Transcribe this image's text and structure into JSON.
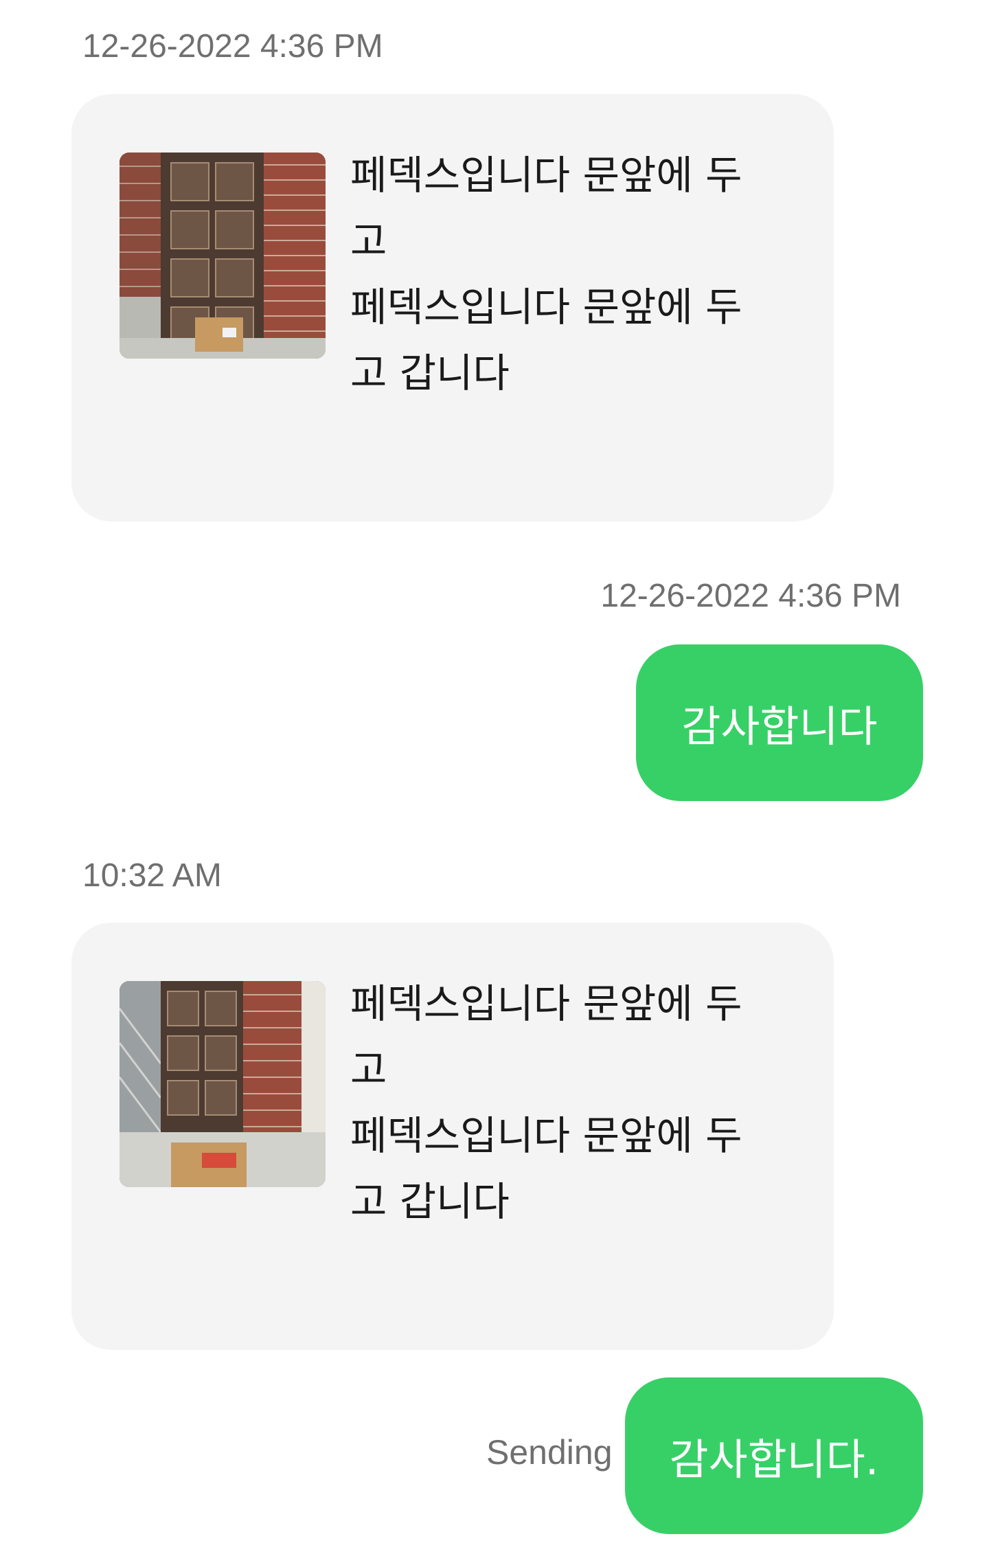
{
  "messages": [
    {
      "direction": "incoming",
      "timestamp": "12-26-2022 4:36 PM",
      "lines": [
        "페덱스입니다 문앞에 두",
        "고",
        "페덱스입니다 문앞에 두",
        "고 갑니다"
      ],
      "photo_icon": "package-at-door-photo"
    },
    {
      "direction": "outgoing",
      "timestamp": "12-26-2022 4:36 PM",
      "text": "감사합니다"
    },
    {
      "direction": "incoming",
      "timestamp": "10:32 AM",
      "lines": [
        "페덱스입니다 문앞에 두",
        "고",
        "페덱스입니다 문앞에 두",
        "고 갑니다"
      ],
      "photo_icon": "package-at-door-photo"
    },
    {
      "direction": "outgoing",
      "status": "Sending",
      "text": "감사합니다."
    }
  ],
  "colors": {
    "incoming_bubble": "#f4f4f4",
    "outgoing_bubble": "#37d067",
    "timestamp_text": "#6f6f6f",
    "message_text": "#1a1a1a"
  }
}
